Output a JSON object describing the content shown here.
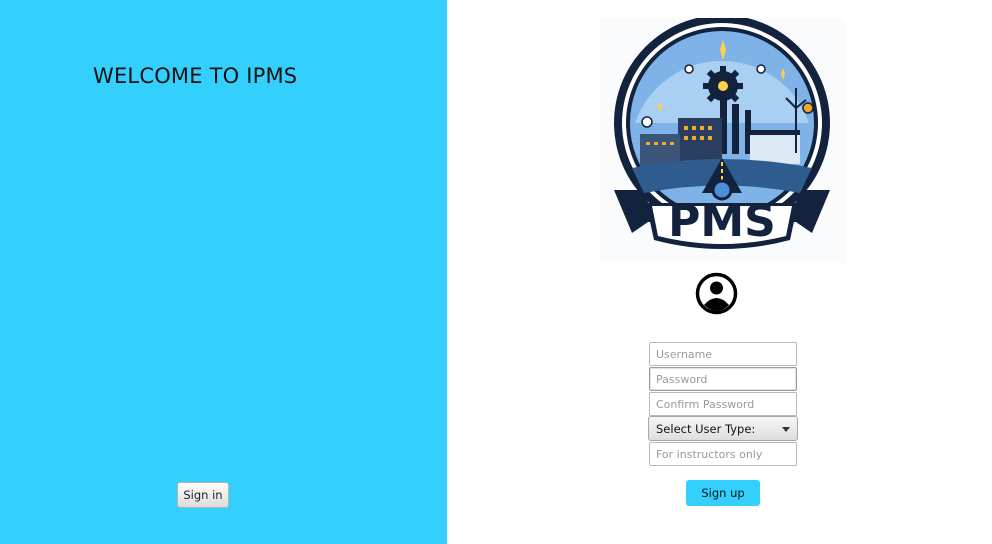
{
  "left": {
    "welcome_text": "WELCOME TO IPMS",
    "signin_label": "Sign in",
    "background_color": "#33d0fe"
  },
  "logo": {
    "text": "PMS",
    "icon": "factory-emblem-logo"
  },
  "avatar": {
    "icon": "user-avatar-icon"
  },
  "form": {
    "username_placeholder": "Username",
    "password_placeholder": "Password",
    "confirm_password_placeholder": "Confirm Password",
    "user_type_selected": "Select User Type:",
    "instructor_placeholder": "For instructors only",
    "signup_label": "Sign up"
  },
  "colors": {
    "accent": "#33d0fe",
    "logo_dark": "#13233d",
    "logo_blue": "#4d8fd6"
  }
}
